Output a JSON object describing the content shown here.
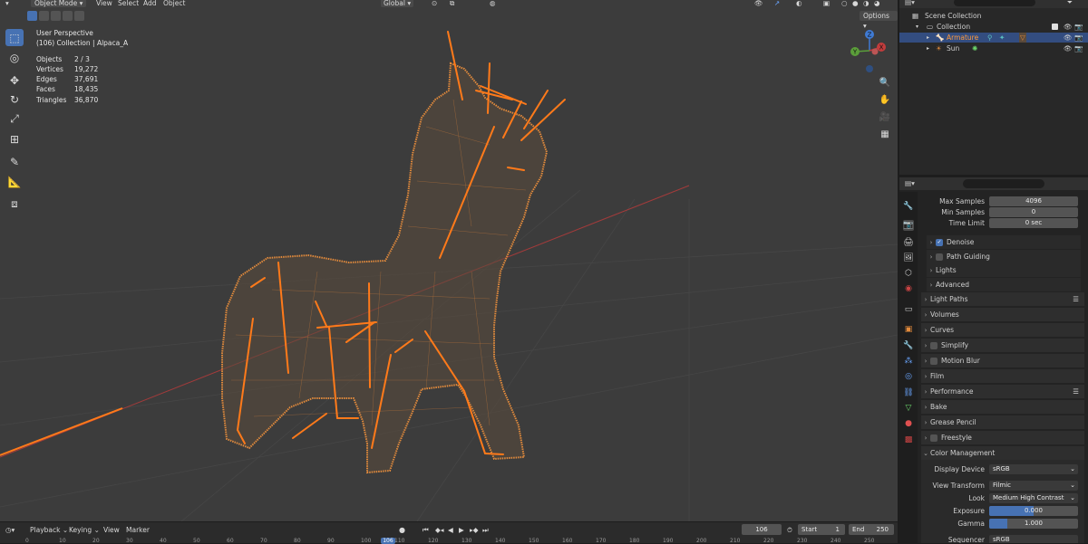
{
  "header": {
    "mode": "Object Mode",
    "menus": [
      "View",
      "Select",
      "Add",
      "Object"
    ],
    "transform_orientation": "Global",
    "options_label": "Options"
  },
  "viewport": {
    "perspective": "User Perspective",
    "collection_info": "(106) Collection | Alpaca_A",
    "stats": [
      {
        "label": "Objects",
        "value": "2 / 3"
      },
      {
        "label": "Vertices",
        "value": "19,272"
      },
      {
        "label": "Edges",
        "value": "37,691"
      },
      {
        "label": "Faces",
        "value": "18,435"
      },
      {
        "label": "Triangles",
        "value": "36,870"
      }
    ],
    "gizmo": {
      "z": "Z",
      "y": "Y",
      "x": "X"
    },
    "colors": {
      "background": "#3c3c3c",
      "wire": "#e38b3c",
      "bone": "#ff7a1a",
      "x_axis": "#a33b3b"
    }
  },
  "outliner": {
    "root": "Scene Collection",
    "collection": "Collection",
    "items": [
      {
        "name": "Armature",
        "selected": true
      },
      {
        "name": "Sun",
        "selected": false
      }
    ]
  },
  "properties": {
    "sampling": [
      {
        "label": "Max Samples",
        "value": "4096"
      },
      {
        "label": "Min Samples",
        "value": "0"
      },
      {
        "label": "Time Limit",
        "value": "0 sec"
      }
    ],
    "subpanels": [
      {
        "label": "Denoise",
        "checkbox": true,
        "checked": true
      },
      {
        "label": "Path Guiding",
        "checkbox": true,
        "checked": false
      },
      {
        "label": "Lights",
        "checkbox": false
      },
      {
        "label": "Advanced",
        "checkbox": false
      }
    ],
    "panels": [
      {
        "label": "Light Paths",
        "checkbox": false,
        "list": true
      },
      {
        "label": "Volumes",
        "checkbox": false,
        "list": false
      },
      {
        "label": "Curves",
        "checkbox": false,
        "list": false
      },
      {
        "label": "Simplify",
        "checkbox": true,
        "list": false
      },
      {
        "label": "Motion Blur",
        "checkbox": true,
        "list": false
      },
      {
        "label": "Film",
        "checkbox": false,
        "list": false
      },
      {
        "label": "Performance",
        "checkbox": false,
        "list": true
      },
      {
        "label": "Bake",
        "checkbox": false,
        "list": false
      },
      {
        "label": "Grease Pencil",
        "checkbox": false,
        "list": false
      },
      {
        "label": "Freestyle",
        "checkbox": true,
        "list": false
      },
      {
        "label": "Color Management",
        "checkbox": false,
        "list": false,
        "expanded": true
      }
    ],
    "color_management": [
      {
        "label": "Display Device",
        "value": "sRGB",
        "type": "dropdown"
      },
      {
        "label": "View Transform",
        "value": "Filmic",
        "type": "dropdown"
      },
      {
        "label": "Look",
        "value": "Medium High Contrast",
        "type": "dropdown"
      },
      {
        "label": "Exposure",
        "value": "0.000",
        "type": "slider",
        "level": 0.5
      },
      {
        "label": "Gamma",
        "value": "1.000",
        "type": "slider",
        "level": 0.2
      },
      {
        "label": "Sequencer",
        "value": "sRGB",
        "type": "dropdown"
      }
    ]
  },
  "timeline": {
    "menus": [
      "Playback",
      "Keying",
      "View",
      "Marker"
    ],
    "current_frame": "106",
    "start_label": "Start",
    "start_value": "1",
    "end_label": "End",
    "end_value": "250",
    "ruler": [
      "0",
      "10",
      "20",
      "30",
      "40",
      "50",
      "60",
      "70",
      "80",
      "90",
      "100",
      "106",
      "110",
      "120",
      "130",
      "140",
      "150",
      "160",
      "170",
      "180",
      "190",
      "200",
      "210",
      "220",
      "230",
      "240",
      "250"
    ]
  }
}
